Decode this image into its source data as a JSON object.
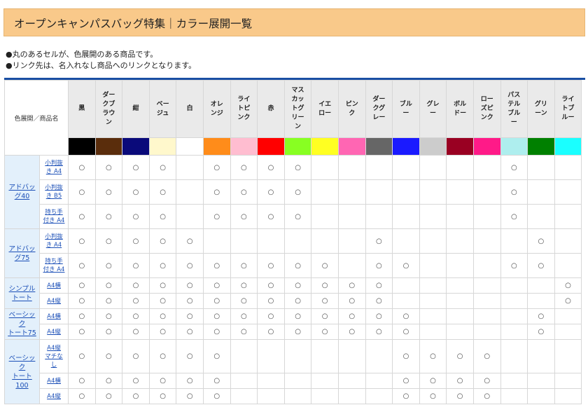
{
  "title": "オープンキャンパスバッグ特集｜カラー展開一覧",
  "notes": [
    "●丸のあるセルが、色展開のある商品です。",
    "●リンク先は、名入れなし商品へのリンクとなります。"
  ],
  "table": {
    "corner_label": "色展開／商品名",
    "mark": "○",
    "colors": [
      {
        "name": "黒",
        "lines": [
          "黒"
        ],
        "hex": "#000000"
      },
      {
        "name": "ダークブラウン",
        "lines": [
          "ダー",
          "クブ",
          "ラウ",
          "ン"
        ],
        "hex": "#5a2d0c"
      },
      {
        "name": "紺",
        "lines": [
          "紺"
        ],
        "hex": "#0a0a7a"
      },
      {
        "name": "ベージュ",
        "lines": [
          "ベー",
          "ジュ"
        ],
        "hex": "#fff8cc"
      },
      {
        "name": "白",
        "lines": [
          "白"
        ],
        "hex": "#ffffff"
      },
      {
        "name": "オレンジ",
        "lines": [
          "オレ",
          "ンジ"
        ],
        "hex": "#ff8c1a"
      },
      {
        "name": "ライトピンク",
        "lines": [
          "ライ",
          "トピ",
          "ンク"
        ],
        "hex": "#ffbdd0"
      },
      {
        "name": "赤",
        "lines": [
          "赤"
        ],
        "hex": "#ff0000"
      },
      {
        "name": "マスカットグリーン",
        "lines": [
          "マス",
          "カッ",
          "トグ",
          "リー",
          "ン"
        ],
        "hex": "#88ff22"
      },
      {
        "name": "イエロー",
        "lines": [
          "イエ",
          "ロー"
        ],
        "hex": "#ffff22"
      },
      {
        "name": "ピンク",
        "lines": [
          "ピン",
          "ク"
        ],
        "hex": "#ff66b3"
      },
      {
        "name": "ダークグレー",
        "lines": [
          "ダー",
          "クグ",
          "レー"
        ],
        "hex": "#666666"
      },
      {
        "name": "ブルー",
        "lines": [
          "ブル",
          "ー"
        ],
        "hex": "#1a1aff"
      },
      {
        "name": "グレー",
        "lines": [
          "グレ",
          "ー"
        ],
        "hex": "#cccccc"
      },
      {
        "name": "ボルドー",
        "lines": [
          "ボル",
          "ドー"
        ],
        "hex": "#990022"
      },
      {
        "name": "ローズピンク",
        "lines": [
          "ロー",
          "ズピ",
          "ンク"
        ],
        "hex": "#ff1a88"
      },
      {
        "name": "パステルブルー",
        "lines": [
          "パス",
          "テル",
          "ブル",
          "ー"
        ],
        "hex": "#aeeeee"
      },
      {
        "name": "グリーン",
        "lines": [
          "グリ",
          "ーン"
        ],
        "hex": "#008000"
      },
      {
        "name": "ライトブルー",
        "lines": [
          "ライ",
          "トブ",
          "ルー"
        ],
        "hex": "#1affff"
      }
    ],
    "groups": [
      {
        "name": "アドバッグ40",
        "lines": [
          "アドバッ",
          "グ40"
        ],
        "rows": [
          {
            "lines": [
              "小判抜",
              "き A4"
            ],
            "marks": [
              1,
              1,
              1,
              1,
              0,
              1,
              1,
              1,
              1,
              0,
              0,
              0,
              0,
              0,
              0,
              0,
              1,
              0,
              0
            ]
          },
          {
            "lines": [
              "小判抜",
              "き B5"
            ],
            "marks": [
              1,
              1,
              1,
              1,
              0,
              1,
              1,
              1,
              1,
              0,
              0,
              0,
              0,
              0,
              0,
              0,
              1,
              0,
              0
            ]
          },
          {
            "lines": [
              "持ち手",
              "付き A4"
            ],
            "marks": [
              1,
              1,
              1,
              1,
              0,
              1,
              1,
              1,
              1,
              0,
              0,
              0,
              0,
              0,
              0,
              0,
              1,
              0,
              0
            ]
          }
        ]
      },
      {
        "name": "アドバッグ75",
        "lines": [
          "アドバッ",
          "グ75"
        ],
        "rows": [
          {
            "lines": [
              "小判抜",
              "き A4"
            ],
            "marks": [
              1,
              1,
              1,
              1,
              1,
              0,
              0,
              0,
              0,
              0,
              0,
              1,
              0,
              0,
              0,
              0,
              0,
              1,
              0
            ]
          },
          {
            "lines": [
              "持ち手",
              "付き A4"
            ],
            "marks": [
              1,
              1,
              1,
              1,
              1,
              1,
              1,
              1,
              1,
              1,
              0,
              1,
              1,
              0,
              0,
              0,
              1,
              1,
              0
            ]
          }
        ]
      },
      {
        "name": "シンプルトート",
        "lines": [
          "シンプル",
          "トート"
        ],
        "rows": [
          {
            "lines": [
              "A4横"
            ],
            "marks": [
              1,
              1,
              1,
              1,
              1,
              1,
              1,
              1,
              1,
              1,
              1,
              1,
              0,
              0,
              0,
              0,
              0,
              0,
              1
            ]
          },
          {
            "lines": [
              "A4縦"
            ],
            "marks": [
              1,
              1,
              1,
              1,
              1,
              1,
              1,
              1,
              1,
              1,
              1,
              1,
              0,
              0,
              0,
              0,
              0,
              0,
              1
            ]
          }
        ]
      },
      {
        "name": "ベーシックトート75",
        "lines": [
          "ベーシッ",
          "ク",
          "トート75"
        ],
        "rows": [
          {
            "lines": [
              "A4横"
            ],
            "marks": [
              1,
              1,
              1,
              1,
              1,
              1,
              1,
              1,
              1,
              1,
              1,
              1,
              1,
              0,
              0,
              0,
              0,
              1,
              0
            ]
          },
          {
            "lines": [
              "A4縦"
            ],
            "marks": [
              1,
              1,
              1,
              1,
              1,
              1,
              1,
              1,
              1,
              1,
              1,
              1,
              1,
              0,
              0,
              0,
              0,
              1,
              0
            ]
          }
        ]
      },
      {
        "name": "ベーシックトート100",
        "lines": [
          "ベーシッ",
          "ク",
          "トート",
          "100"
        ],
        "rows": [
          {
            "lines": [
              "A4縦",
              "マチな",
              "し"
            ],
            "marks": [
              1,
              1,
              1,
              1,
              1,
              1,
              0,
              0,
              0,
              0,
              0,
              0,
              1,
              1,
              1,
              1,
              0,
              0,
              0
            ]
          },
          {
            "lines": [
              "A4横"
            ],
            "marks": [
              1,
              1,
              1,
              1,
              1,
              1,
              0,
              0,
              0,
              0,
              0,
              0,
              1,
              1,
              1,
              1,
              0,
              0,
              0
            ]
          },
          {
            "lines": [
              "A4縦"
            ],
            "marks": [
              1,
              1,
              1,
              1,
              1,
              1,
              0,
              0,
              0,
              0,
              0,
              0,
              1,
              1,
              1,
              1,
              0,
              0,
              0
            ]
          }
        ]
      }
    ]
  }
}
